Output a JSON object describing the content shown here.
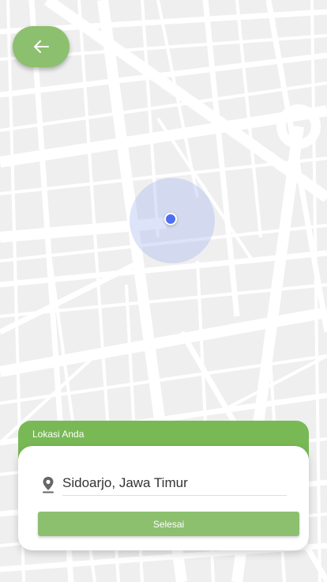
{
  "map": {
    "background_color": "#efefef",
    "road_color": "#ffffff"
  },
  "back_button": {
    "icon": "arrow-left-icon",
    "color": "#8cc06f"
  },
  "location_marker": {
    "dot_color": "#4f6ff0"
  },
  "location_sheet": {
    "title": "Lokasi Anda",
    "header_color": "#78b955",
    "pin_icon": "map-pin-icon",
    "location_value": "Sidoarjo, Jawa Timur",
    "done_label": "Selesai",
    "done_color": "#8cc06f"
  }
}
